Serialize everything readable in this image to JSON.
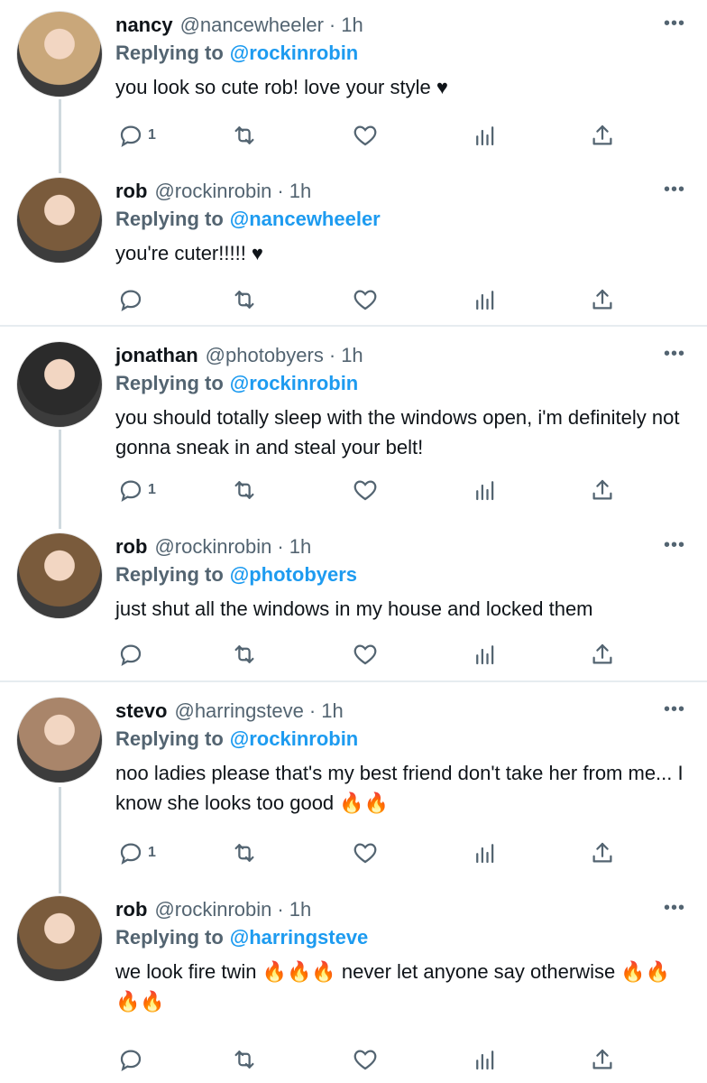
{
  "tweets": [
    {
      "name": "nancy",
      "handle": "@nancewheeler",
      "dot": "·",
      "time": "1h",
      "replying_prefix": "Replying to",
      "replying_to": "@rockinrobin",
      "text": "you look so cute rob! love your style ♥",
      "reply_count": "1",
      "more": "•••",
      "avatar_color": "#c9a77a"
    },
    {
      "name": "rob",
      "handle": "@rockinrobin",
      "dot": "·",
      "time": "1h",
      "replying_prefix": "Replying to",
      "replying_to": "@nancewheeler",
      "text": "you're cuter!!!!! ♥",
      "reply_count": "",
      "more": "•••",
      "avatar_color": "#7a5b3c"
    },
    {
      "name": "jonathan",
      "handle": "@photobyers",
      "dot": "·",
      "time": "1h",
      "replying_prefix": "Replying to",
      "replying_to": "@rockinrobin",
      "text": "you should totally sleep with the windows open, i'm definitely not gonna sneak in and steal your belt!",
      "reply_count": "1",
      "more": "•••",
      "avatar_color": "#2b2b2b"
    },
    {
      "name": "rob",
      "handle": "@rockinrobin",
      "dot": "·",
      "time": "1h",
      "replying_prefix": "Replying to",
      "replying_to": "@photobyers",
      "text": "just shut all the windows in my house and locked them",
      "reply_count": "",
      "more": "•••",
      "avatar_color": "#7a5b3c"
    },
    {
      "name": "stevo",
      "handle": "@harringsteve",
      "dot": "·",
      "time": "1h",
      "replying_prefix": "Replying to",
      "replying_to": "@rockinrobin",
      "text": "noo ladies please that's my best friend don't take her from me... I know she looks too good 🔥🔥",
      "reply_count": "1",
      "more": "•••",
      "avatar_color": "#a9856a"
    },
    {
      "name": "rob",
      "handle": "@rockinrobin",
      "dot": "·",
      "time": "1h",
      "replying_prefix": "Replying to",
      "replying_to": "@harringsteve",
      "text": "we look fire twin 🔥🔥🔥 never let anyone say otherwise 🔥🔥🔥🔥",
      "reply_count": "",
      "more": "•••",
      "avatar_color": "#7a5b3c"
    }
  ],
  "icons": {
    "reply": "reply-icon",
    "retweet": "retweet-icon",
    "like": "heart-icon",
    "analytics": "analytics-icon",
    "share": "share-icon",
    "more": "more-icon"
  },
  "colors": {
    "accent": "#1d9bf0",
    "secondary_text": "#536471",
    "primary_text": "#0f1419",
    "thread_line": "#cfd9de",
    "divider": "#e6ecf0"
  }
}
